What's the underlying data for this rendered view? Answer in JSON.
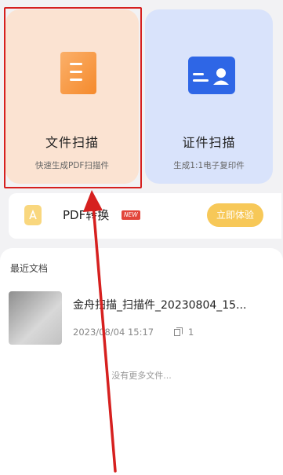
{
  "cards": [
    {
      "title": "文件扫描",
      "subtitle": "快速生成PDF扫描件",
      "icon": "document-scan-icon"
    },
    {
      "title": "证件扫描",
      "subtitle": "生成1:1电子复印件",
      "icon": "id-card-icon"
    }
  ],
  "pdf_convert": {
    "label": "PDF转换",
    "badge": "NEW",
    "button": "立即体验",
    "icon": "pdf-icon"
  },
  "recent": {
    "title": "最近文档",
    "files": [
      {
        "name": "金舟扫描_扫描件_20230804_15...",
        "date": "2023/08/04 15:17",
        "pages": "1"
      }
    ],
    "footer": "没有更多文件..."
  },
  "colors": {
    "annotation_red": "#d6201f",
    "doc_card": "#fbe3d2",
    "id_card": "#d9e3fb",
    "accent_yellow": "#f7c858"
  }
}
